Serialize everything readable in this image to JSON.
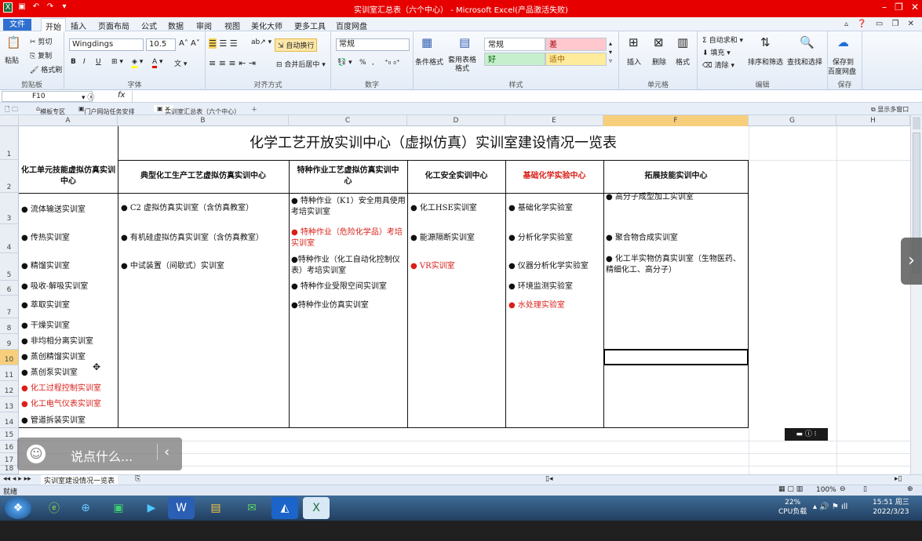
{
  "window": {
    "title": "实训室汇总表（六个中心） - Microsoft Excel(产品激活失败)"
  },
  "menu": {
    "file": "文件",
    "tabs": [
      "开始",
      "插入",
      "页面布局",
      "公式",
      "数据",
      "审阅",
      "视图",
      "美化大师",
      "更多工具",
      "百度网盘"
    ]
  },
  "ribbon": {
    "clipboard": {
      "label": "剪贴板",
      "paste": "粘贴",
      "cut": "剪切",
      "copy": "复制",
      "format_painter": "格式刷"
    },
    "font": {
      "label": "字体",
      "name": "Wingdings",
      "size": "10.5",
      "bold": "B",
      "italic": "I",
      "underline": "U"
    },
    "alignment": {
      "label": "对齐方式",
      "wrap": "自动换行",
      "merge": "合并后居中"
    },
    "number": {
      "label": "数字",
      "format": "常规",
      "percent": "%",
      "comma": ","
    },
    "styles": {
      "label": "样式",
      "cond_format": "条件格式",
      "table_format": "套用表格格式",
      "normal": "常规",
      "bad": "差",
      "good": "好",
      "neutral": "适中"
    },
    "cells": {
      "label": "单元格",
      "insert": "插入",
      "delete": "删除",
      "format": "格式"
    },
    "editing": {
      "label": "编辑",
      "autosum": "自动求和",
      "fill": "填充",
      "clear": "清除",
      "sort_filter": "排序和筛选",
      "find_select": "查找和选择"
    },
    "save": {
      "label": "保存",
      "save_to": "保存到",
      "baidu": "百度网盘"
    }
  },
  "formula_bar": {
    "name_box": "F10",
    "fx": "fx",
    "value": ""
  },
  "workbook_tabs": {
    "items": [
      "模板专区",
      "门户网站任务安排",
      "实训室汇总表（六个中心）"
    ]
  },
  "columns": [
    "A",
    "B",
    "C",
    "D",
    "E",
    "F",
    "G",
    "H"
  ],
  "rows": [
    "1",
    "2",
    "3",
    "4",
    "5",
    "6",
    "7",
    "8",
    "9",
    "10",
    "11",
    "12",
    "13",
    "14",
    "15",
    "16",
    "17",
    "18"
  ],
  "sheet": {
    "title": "化学工艺开放实训中心（虚拟仿真）实训室建设情况一览表",
    "headers": [
      "化工单元技能虚拟仿真实训中心",
      "典型化工生产工艺虚拟仿真实训中心",
      "特种作业工艺虚拟仿真实训中心",
      "化工安全实训中心",
      "基础化学实验中心",
      "拓展技能实训中心"
    ],
    "colA": [
      "● 流体输送实训室",
      "● 传热实训室",
      "● 精馏实训室",
      "● 吸收-解吸实训室",
      "● 萃取实训室",
      "● 干燥实训室",
      "● 非均相分离实训室",
      "● 蒸创精馏实训室",
      "● 蒸创泵实训室",
      "● 化工过程控制实训室",
      "●  化工电气仪表实训室",
      "● 管道拆装实训室"
    ],
    "colB": [
      "● C2 虚拟仿真实训室（含仿真教室）",
      "● 有机硅虚拟仿真实训室（含仿真教室）",
      "● 中试装置（间歇式）实训室"
    ],
    "colC": [
      "● 特种作业（K1）安全用具使用考培实训室",
      "● 特种作业（危险化学品）考培实训室",
      "●特种作业（化工自动化控制仪表）考培实训室",
      "● 特种作业受限空间实训室",
      "●特种作业仿真实训室"
    ],
    "colD": [
      "● 化工HSE实训室",
      "● 能源隔断实训室",
      "● VR实训室"
    ],
    "colE": [
      "● 基础化学实验室",
      "● 分析化学实验室",
      "● 仪器分析化学实验室",
      "● 环境监测实验室",
      "●  水处理实验室"
    ],
    "colF": [
      "● 高分子成型加工实训室",
      "● 聚合物合成实训室",
      "● 化工半实物仿真实训室（生物医药、精细化工、高分子）"
    ]
  },
  "sheet_tabs": {
    "active": "实训室建设情况一览表"
  },
  "status": {
    "ready": "就绪",
    "zoom": "100%"
  },
  "taskbar": {
    "cpu": "22%",
    "cpu_label": "CPU负载",
    "time": "15:51 周三",
    "date": "2022/3/23"
  },
  "overlay": {
    "chat_placeholder": "说点什么..."
  }
}
